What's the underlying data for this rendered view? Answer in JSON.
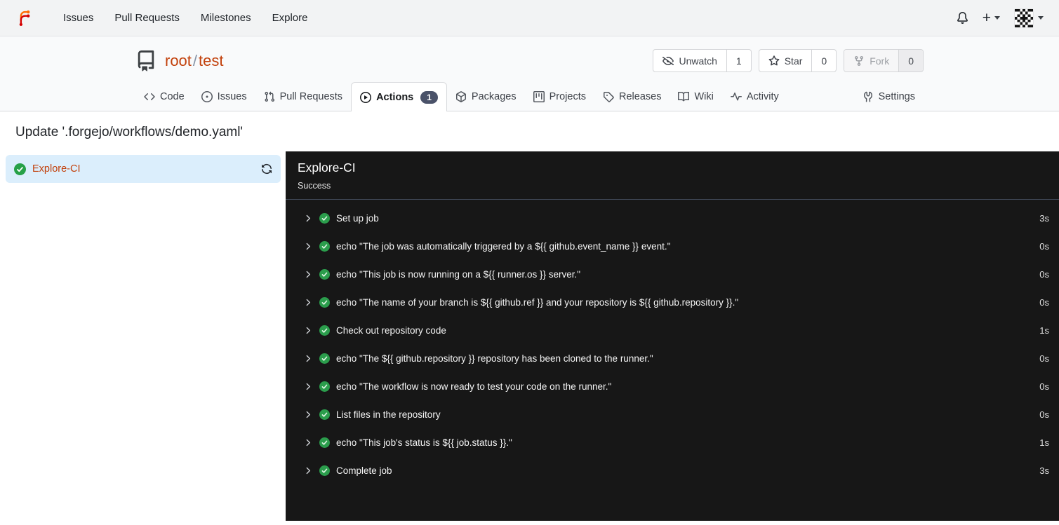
{
  "navbar": {
    "items": [
      {
        "label": "Issues"
      },
      {
        "label": "Pull Requests"
      },
      {
        "label": "Milestones"
      },
      {
        "label": "Explore"
      }
    ],
    "create_label": "+"
  },
  "repo": {
    "owner": "root",
    "separator": "/",
    "name": "test"
  },
  "repo_actions": {
    "unwatch": {
      "label": "Unwatch",
      "count": "1"
    },
    "star": {
      "label": "Star",
      "count": "0"
    },
    "fork": {
      "label": "Fork",
      "count": "0"
    }
  },
  "tabs": [
    {
      "label": "Code"
    },
    {
      "label": "Issues"
    },
    {
      "label": "Pull Requests"
    },
    {
      "label": "Actions",
      "badge": "1",
      "active": true
    },
    {
      "label": "Packages"
    },
    {
      "label": "Projects"
    },
    {
      "label": "Releases"
    },
    {
      "label": "Wiki"
    },
    {
      "label": "Activity"
    },
    {
      "label": "Settings"
    }
  ],
  "run": {
    "title": "Update '.forgejo/workflows/demo.yaml'"
  },
  "sidebar": {
    "job": {
      "name": "Explore-CI",
      "status": "success"
    }
  },
  "panel": {
    "title": "Explore-CI",
    "status": "Success",
    "steps": [
      {
        "name": "Set up job",
        "duration": "3s"
      },
      {
        "name": "echo \"The job was automatically triggered by a ${{ github.event_name }} event.\"",
        "duration": "0s"
      },
      {
        "name": "echo \"This job is now running on a ${{ runner.os }} server.\"",
        "duration": "0s"
      },
      {
        "name": "echo \"The name of your branch is ${{ github.ref }} and your repository is ${{ github.repository }}.\"",
        "duration": "0s"
      },
      {
        "name": "Check out repository code",
        "duration": "1s"
      },
      {
        "name": "echo \"The ${{ github.repository }} repository has been cloned to the runner.\"",
        "duration": "0s"
      },
      {
        "name": "echo \"The workflow is now ready to test your code on the runner.\"",
        "duration": "0s"
      },
      {
        "name": "List files in the repository",
        "duration": "0s"
      },
      {
        "name": "echo \"This job's status is ${{ job.status }}.\"",
        "duration": "1s"
      },
      {
        "name": "Complete job",
        "duration": "3s"
      }
    ]
  },
  "icons": {
    "logo": "forgejo-logo",
    "notifications": "bell-icon",
    "create": "plus-icon",
    "repo": "repo-book-icon",
    "unwatch": "eye-closed-icon",
    "star": "star-icon",
    "fork": "repo-forked-icon",
    "step_status": "check-circle-icon",
    "expand": "chevron-right-icon",
    "rerun": "sync-icon"
  },
  "colors": {
    "accent": "#c2410c",
    "success_green": "#26a148",
    "panel_bg": "#171717",
    "selected_job_bg": "#dbeefc",
    "tab_badge_bg": "#4a5269",
    "header_bg": "#f9fafb",
    "navbar_bg": "#f2f3f4"
  }
}
